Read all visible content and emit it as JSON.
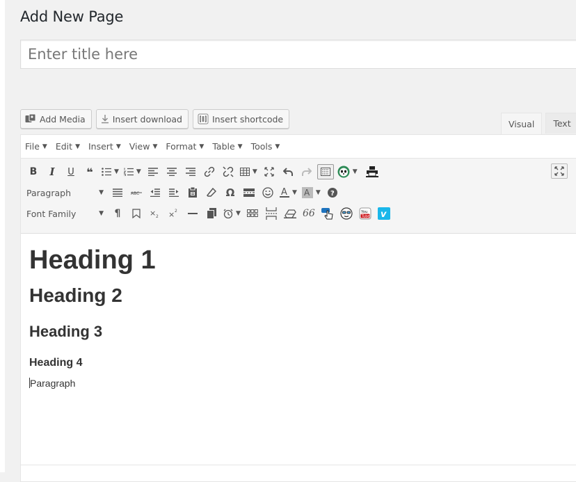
{
  "page": {
    "heading": "Add New Page"
  },
  "title_field": {
    "placeholder": "Enter title here",
    "value": ""
  },
  "media_buttons": [
    {
      "label": "Add Media",
      "icon": "media-icon"
    },
    {
      "label": "Insert download",
      "icon": "download-icon"
    },
    {
      "label": "Insert shortcode",
      "icon": "shortcode-icon"
    }
  ],
  "editor_tabs": [
    {
      "label": "Visual",
      "active": true
    },
    {
      "label": "Text",
      "active": false
    }
  ],
  "menubar": [
    "File",
    "Edit",
    "Insert",
    "View",
    "Format",
    "Table",
    "Tools"
  ],
  "toolbar": {
    "format_select": "Paragraph",
    "font_select": "Font Family",
    "omega": "Ω",
    "italic": "I",
    "bold": "B",
    "underline": "U",
    "quote": "❝",
    "quote66": "66",
    "pilcrow": "¶",
    "help": "?",
    "subscript": "X₂",
    "superscript": "X²"
  },
  "content": {
    "h1": "Heading 1",
    "h2": "Heading 2",
    "h3": "Heading 3",
    "h4": "Heading 4",
    "p": "Paragraph"
  },
  "colors": {
    "accent": "#0073aa",
    "toolbar_bg": "#f5f5f5",
    "vimeo": "#1ab7ea",
    "youtube": "#cc181e"
  }
}
